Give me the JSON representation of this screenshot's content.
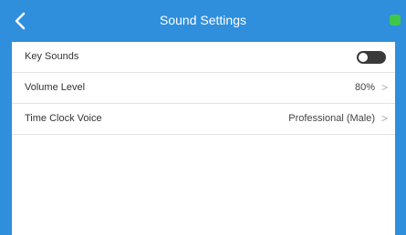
{
  "header": {
    "title": "Sound Settings",
    "back_icon": "chevron-left-icon",
    "status_color": "#3ec84a"
  },
  "settings": [
    {
      "label": "Key Sounds",
      "control": "toggle",
      "on": false
    },
    {
      "label": "Volume Level",
      "value": "80%"
    },
    {
      "label": "Time Clock Voice",
      "value": "Professional (Male)"
    }
  ],
  "chevron_glyph": ">",
  "colors": {
    "accent": "#2f8fdc",
    "toggle_off": "#3a3a3a"
  }
}
